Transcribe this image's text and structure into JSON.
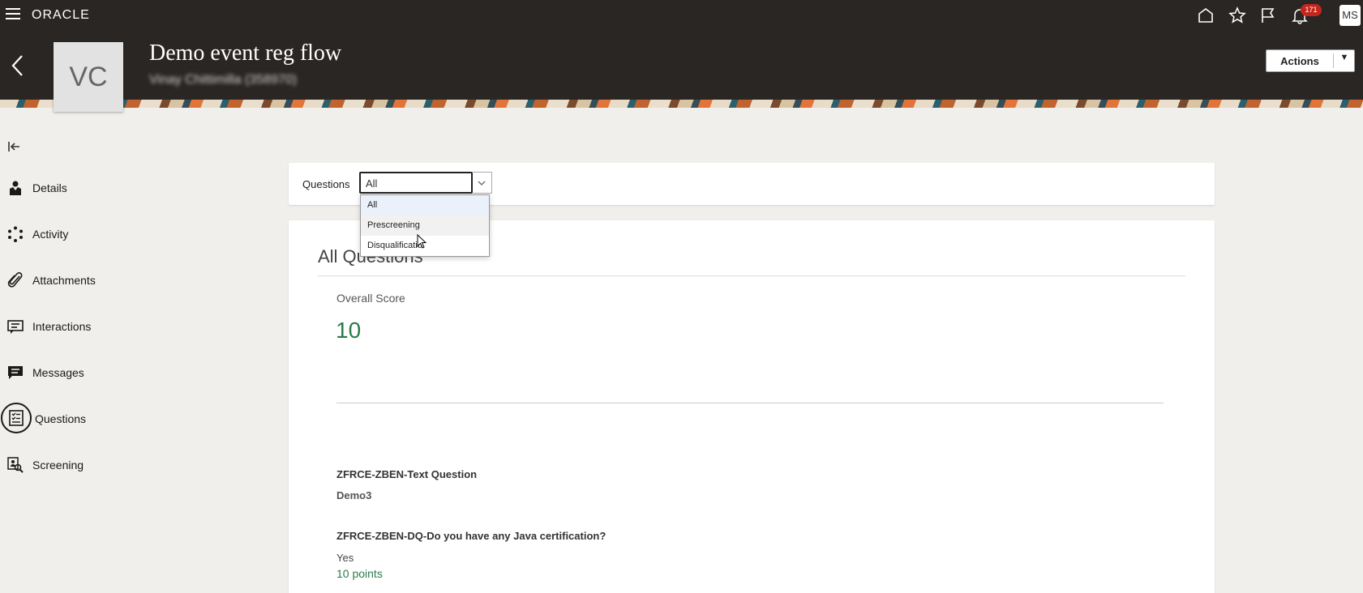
{
  "topbar": {
    "logo": "ORACLE",
    "notification_count": "171",
    "user_initials": "MS",
    "icons": [
      "home-icon",
      "star-icon",
      "flag-icon",
      "bell-icon"
    ]
  },
  "header": {
    "title": "Demo event reg flow",
    "subtitle": "Vinay Chittimilla (358970)",
    "avatar_initials": "VC",
    "actions_label": "Actions"
  },
  "nav": {
    "items": [
      {
        "label": "Details",
        "icon": "person-icon"
      },
      {
        "label": "Activity",
        "icon": "activity-icon"
      },
      {
        "label": "Attachments",
        "icon": "paperclip-icon"
      },
      {
        "label": "Interactions",
        "icon": "interactions-icon"
      },
      {
        "label": "Messages",
        "icon": "message-icon"
      },
      {
        "label": "Questions",
        "icon": "questions-icon",
        "active": true
      },
      {
        "label": "Screening",
        "icon": "screening-icon"
      }
    ]
  },
  "filter": {
    "label": "Questions",
    "value": "All",
    "options": [
      "All",
      "Prescreening",
      "Disqualificatio"
    ]
  },
  "main": {
    "section_title": "All Questions",
    "score_label": "Overall Score",
    "score_value": "10",
    "questions": [
      {
        "title": "ZFRCE-ZBEN-Text Question",
        "answer": "Demo3",
        "points": ""
      },
      {
        "title": "ZFRCE-ZBEN-DQ-Do you have any Java certification?",
        "answer": "Yes",
        "points": "10 points"
      }
    ]
  },
  "colors": {
    "header_bg": "#2a2624",
    "score_green": "#2b7a4b",
    "badge_red": "#c4261c"
  }
}
